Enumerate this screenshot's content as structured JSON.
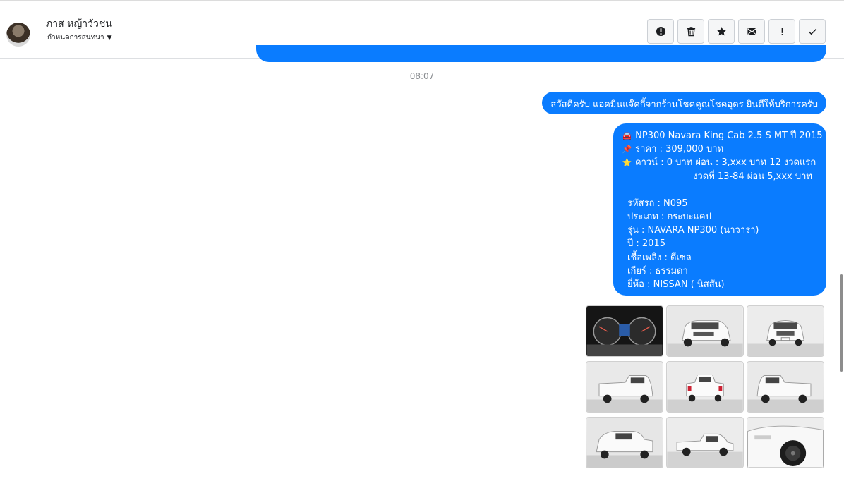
{
  "header": {
    "name": "ภาส หญ้าวัวชน",
    "subtitle": "กำหนดการสนทนา",
    "actions": [
      {
        "name": "report-spam",
        "icon": "alert-circle-icon"
      },
      {
        "name": "delete",
        "icon": "trash-icon"
      },
      {
        "name": "star",
        "icon": "star-icon"
      },
      {
        "name": "mark-unread",
        "icon": "envelope-icon"
      },
      {
        "name": "flag",
        "icon": "exclamation-icon"
      },
      {
        "name": "done",
        "icon": "check-icon"
      }
    ]
  },
  "chat": {
    "timestamp": "08:07",
    "greeting": "สวัสดีครับ แอดมินแจ๊คกี้จากร้านโชคคูณโชคอุดร ยินดีให้บริการครับ",
    "listing": {
      "title": "NP300 Navara King Cab 2.5 S MT ปี 2015",
      "price": "ราคา : 309,000 บาท",
      "down": "ดาวน์ : 0 บาท ผ่อน : 3,xxx บาท 12 งวดแรก",
      "installment": "งวดที่ 13-84 ผ่อน 5,xxx บาท",
      "code": "รหัสรถ : N095",
      "type": "ประเภท : กระบะแคป",
      "model": "รุ่น : NAVARA NP300 (นาวาร่า)",
      "year": "ปี : 2015",
      "fuel": "เชื้อเพลิง : ดีเซล",
      "gear": "เกียร์ : ธรรมดา",
      "brand": "ยี่ห้อ : NISSAN ( นิสสัน)",
      "emoji_title": "🚘",
      "emoji_price": "📌",
      "emoji_down": "⭐"
    },
    "photos": [
      "dashboard",
      "front-right",
      "front",
      "rear-left",
      "rear",
      "rear-right",
      "front-left",
      "side",
      "wheel-closeup"
    ]
  }
}
